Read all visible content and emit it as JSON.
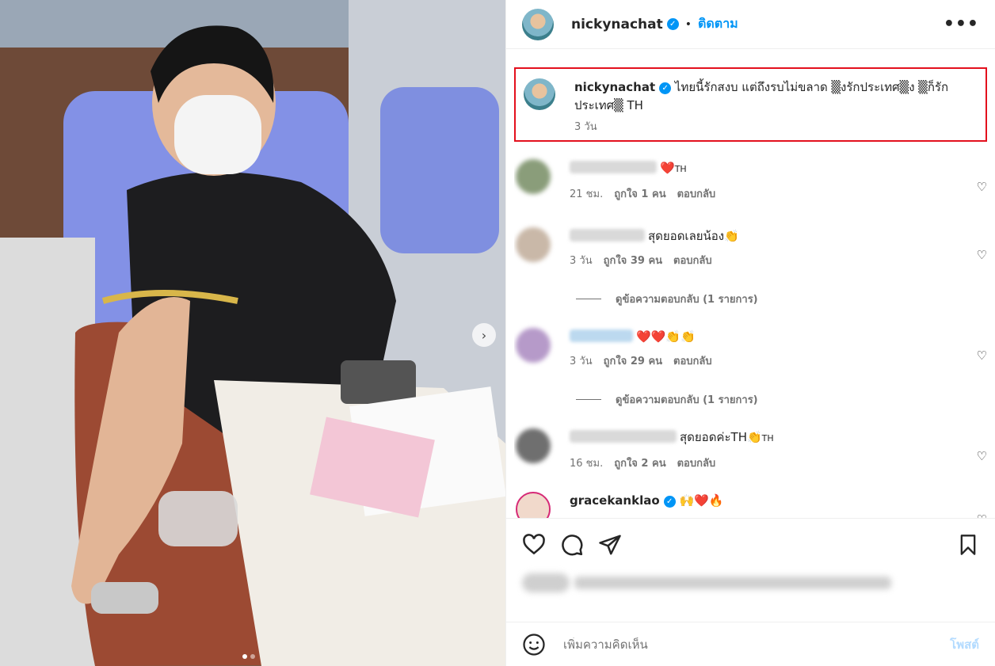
{
  "header": {
    "username": "nickynachat",
    "separator": "•",
    "follow_label": "ติดตาม",
    "more_label": "•••"
  },
  "caption": {
    "username": "nickynachat",
    "text": "ไทยนี้รักสงบ แต่ถึงรบไม่ขลาด ▒งรักประเทศ▒ง ▒ก็รักประเทศ▒ TH",
    "time": "3 วัน"
  },
  "comments": [
    {
      "text": "❤️",
      "suffix": "TH",
      "time": "21 ชม.",
      "likes": "ถูกใจ 1 คน",
      "reply": "ตอบกลับ"
    },
    {
      "text": "สุดยอดเลยน้อง👏",
      "suffix": "",
      "time": "3 วัน",
      "likes": "ถูกใจ 39 คน",
      "reply": "ตอบกลับ",
      "view_replies": "ดูข้อความตอบกลับ (1 รายการ)"
    },
    {
      "text": "❤️❤️👏👏",
      "suffix": "",
      "time": "3 วัน",
      "likes": "ถูกใจ 29 คน",
      "reply": "ตอบกลับ",
      "view_replies": "ดูข้อความตอบกลับ (1 รายการ)"
    },
    {
      "text": "สุดยอดค่ะTH👏",
      "suffix": "TH",
      "time": "16 ชม.",
      "likes": "ถูกใจ 2 คน",
      "reply": "ตอบกลับ"
    },
    {
      "username": "gracekanklao",
      "text": "🙌❤️🔥"
    }
  ],
  "composer": {
    "placeholder": "เพิ่มความคิดเห็น",
    "post_label": "โพสต์"
  },
  "icons": {
    "like": "heart-icon",
    "comment": "comment-icon",
    "share": "share-icon",
    "save": "bookmark-icon",
    "emoji": "emoji-icon",
    "next": "chevron-right-icon"
  },
  "colors": {
    "follow": "#0095f6",
    "verified": "#0095f6",
    "highlight": "#e3101d",
    "post_disabled": "#b3dbff"
  },
  "carousel": {
    "count": 2,
    "active": 0
  }
}
